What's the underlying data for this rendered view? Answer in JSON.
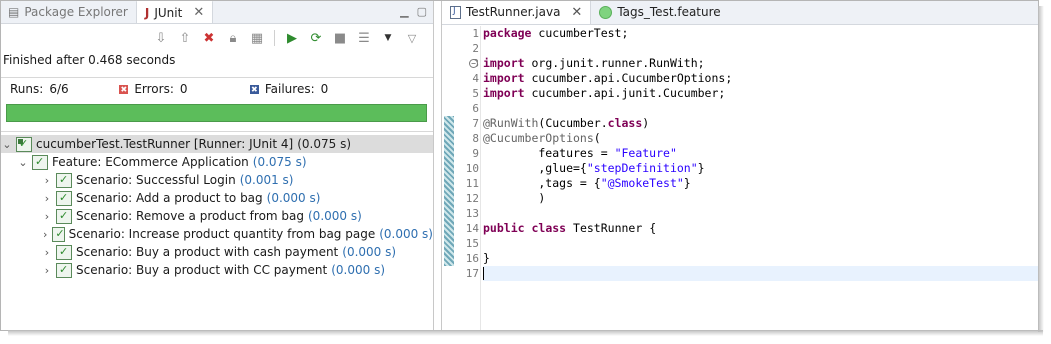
{
  "left_tabs": {
    "package_explorer": "Package Explorer",
    "junit": "JUnit"
  },
  "junit": {
    "finished": "Finished after 0.468 seconds",
    "runs_label": "Runs:",
    "runs_value": "6/6",
    "errors_label": "Errors:",
    "errors_value": "0",
    "failures_label": "Failures:",
    "failures_value": "0",
    "progress": 1.0,
    "progress_color": "#5cbd5b"
  },
  "tree": {
    "root": {
      "label": "cucumberTest.TestRunner [Runner: JUnit 4]",
      "time": "(0.075 s)"
    },
    "feature": {
      "label": "Feature: ECommerce Application",
      "time": "(0.075 s)"
    },
    "scenarios": [
      {
        "label": "Scenario: Successful Login",
        "time": "(0.001 s)"
      },
      {
        "label": "Scenario: Add a product to bag",
        "time": "(0.000 s)"
      },
      {
        "label": "Scenario: Remove a product from bag",
        "time": "(0.000 s)"
      },
      {
        "label": "Scenario: Increase product quantity from bag page",
        "time": "(0.000 s)"
      },
      {
        "label": "Scenario: Buy a product with cash payment",
        "time": "(0.000 s)"
      },
      {
        "label": "Scenario: Buy a product with CC payment",
        "time": "(0.000 s)"
      }
    ]
  },
  "editor_tabs": {
    "java": "TestRunner.java",
    "feature": "Tags_Test.feature"
  },
  "code": {
    "line_numbers": [
      "1",
      "2",
      "3",
      "4",
      "5",
      "6",
      "7",
      "8",
      "9",
      "10",
      "11",
      "12",
      "13",
      "14",
      "15",
      "16",
      "17"
    ],
    "l1_kw": "package",
    "l1_rest": " cucumberTest;",
    "l3_kw": "import",
    "l3_rest": " org.junit.runner.RunWith;",
    "l4_kw": "import",
    "l4_rest": " cucumber.api.CucumberOptions;",
    "l5_kw": "import",
    "l5_rest": " cucumber.api.junit.Cucumber;",
    "l7_ann": "@RunWith",
    "l7_a": "(Cucumber.",
    "l7_kw": "class",
    "l7_b": ")",
    "l8_ann": "@CucumberOptions",
    "l8_a": "(",
    "l9_a": "        features = ",
    "l9_str": "\"Feature\"",
    "l10_a": "        ,glue={",
    "l10_str": "\"stepDefinition\"",
    "l10_b": "}",
    "l11_a": "        ,tags = {",
    "l11_str": "\"@SmokeTest\"",
    "l11_b": "}",
    "l12_a": "        )",
    "l14_kw1": "public",
    "l14_sp": " ",
    "l14_kw2": "class",
    "l14_rest": " TestRunner {",
    "l16_a": "}"
  }
}
